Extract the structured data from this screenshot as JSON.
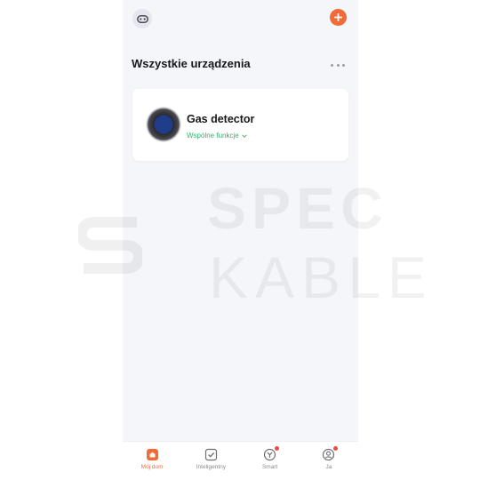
{
  "header": {
    "home_icon": "gamepad-icon",
    "add_icon": "plus-icon"
  },
  "devices_section": {
    "title": "Wszystkie urządzenia",
    "more_icon": "more-dots-icon"
  },
  "devices": [
    {
      "name": "Gas detector",
      "link_label": "Wspólne funkcje",
      "link_icon": "chevron-down-icon"
    }
  ],
  "watermark": {
    "line1": "SPEC",
    "line2": "KABLE"
  },
  "tabbar": {
    "tabs": [
      {
        "label": "Mój dom",
        "icon": "home-icon",
        "active": true,
        "badge": false
      },
      {
        "label": "Inteligentny",
        "icon": "check-square-icon",
        "active": false,
        "badge": false
      },
      {
        "label": "Smart",
        "icon": "smart-icon",
        "active": false,
        "badge": true
      },
      {
        "label": "Ja",
        "icon": "user-icon",
        "active": false,
        "badge": true
      }
    ]
  },
  "colors": {
    "accent": "#f26a36",
    "background": "#f5f6fa",
    "link_green": "#33b36b",
    "badge_red": "#f04848"
  }
}
